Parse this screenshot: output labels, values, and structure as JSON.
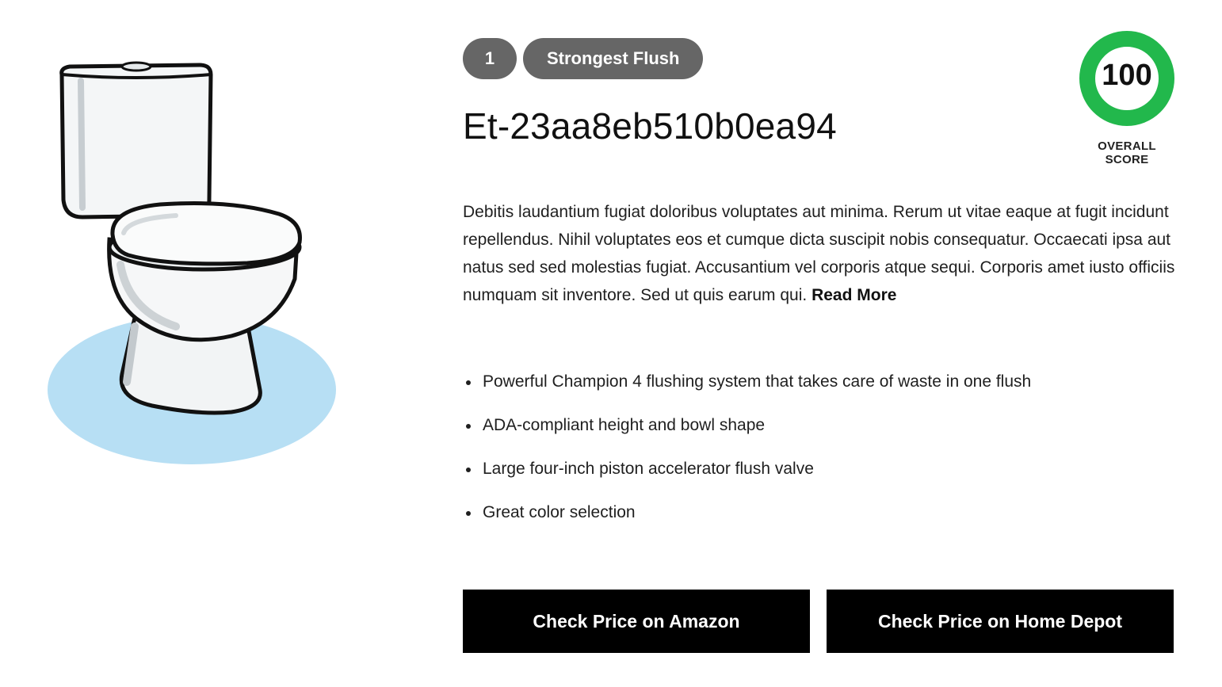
{
  "product": {
    "rank": "1",
    "tag": "Strongest Flush",
    "title": "Et-23aa8eb510b0ea94",
    "description": "Debitis laudantium fugiat doloribus voluptates aut minima. Rerum ut vitae eaque at fugit incidunt repellendus. Nihil voluptates eos et cumque dicta suscipit nobis consequatur. Occaecati ipsa aut natus sed sed molestias fugiat. Accusantium vel corporis atque sequi. Corporis amet iusto officiis numquam sit inventore. Sed ut quis earum qui.",
    "read_more": "Read More",
    "image_icon": "toilet-illustration"
  },
  "score": {
    "value": "100",
    "label": "OVERALL SCORE",
    "ring_color": "#22b84c"
  },
  "features": [
    "Powerful Champion 4 flushing system that takes care of waste in one flush",
    "ADA-compliant height and bowl shape",
    "Large four-inch piston accelerator flush valve",
    "Great color selection"
  ],
  "buttons": {
    "amazon": "Check Price on Amazon",
    "home_depot": "Check Price on Home Depot"
  }
}
